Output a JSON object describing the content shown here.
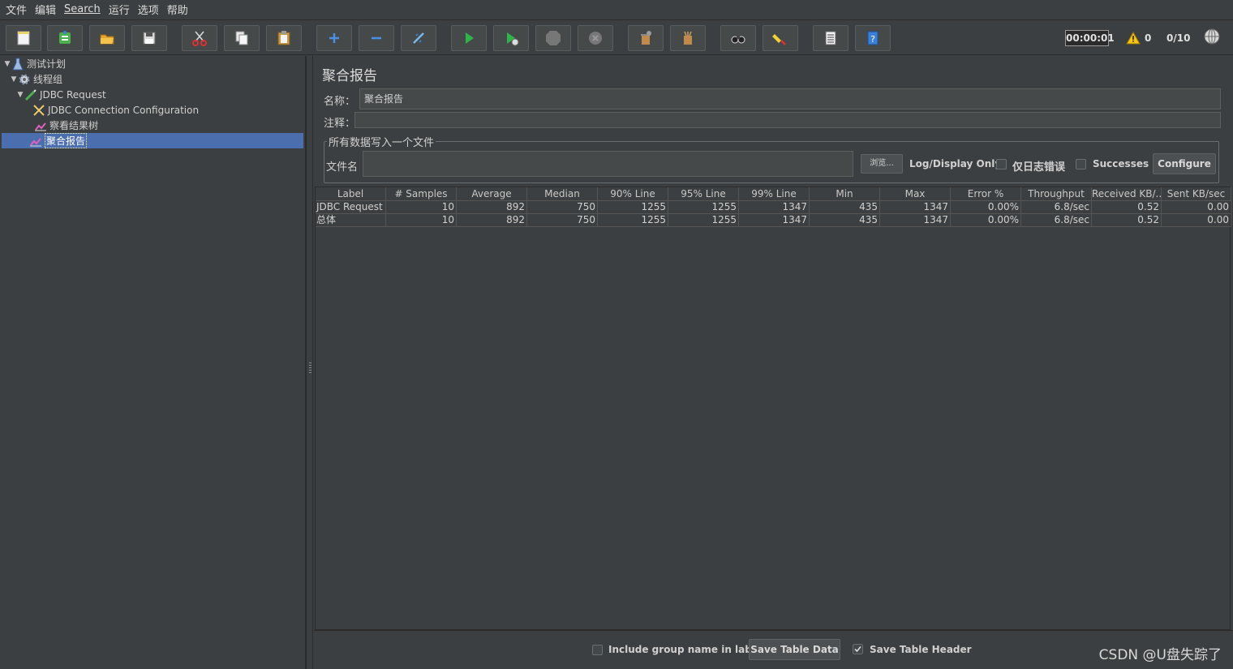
{
  "menu": [
    "文件",
    "编辑",
    "Search",
    "运行",
    "选项",
    "帮助"
  ],
  "toolbar": {
    "icons": [
      "new-icon",
      "templates-icon",
      "open-icon",
      "save-icon",
      "cut-icon",
      "copy-icon",
      "paste-icon",
      "expand-icon",
      "collapse-icon",
      "toggle-icon",
      "start-icon",
      "start-no-pause-icon",
      "stop-icon",
      "shutdown-icon",
      "clear-icon",
      "clear-all-icon",
      "search-icon",
      "reset-search-icon",
      "function-helper-icon",
      "help-icon"
    ],
    "timer": "00:00:01",
    "warnings": "0",
    "threads": "0/10"
  },
  "tree": [
    {
      "label": "测试计划",
      "icon": "test-plan-icon",
      "expanded": true
    },
    {
      "label": "线程组",
      "icon": "thread-group-icon",
      "expanded": true
    },
    {
      "label": "JDBC Request",
      "icon": "jdbc-request-icon",
      "expanded": true
    },
    {
      "label": "JDBC Connection Configuration",
      "icon": "config-icon"
    },
    {
      "label": "察看结果树",
      "icon": "listener-icon"
    },
    {
      "label": "聚合报告",
      "icon": "listener-icon",
      "selected": true
    }
  ],
  "panel": {
    "title": "聚合报告",
    "name_label": "名称：",
    "name_value": "聚合报告",
    "comment_label": "注释：",
    "comment_value": "",
    "file_group_title": "所有数据写入一个文件",
    "filename_label": "文件名",
    "filename_value": "",
    "browse_label": "浏览...",
    "log_display_label": "Log/Display Only:",
    "errors_only_label": "仅日志错误",
    "successes_label": "Successes",
    "configure_label": "Configure"
  },
  "table": {
    "headers": [
      "Label",
      "# Samples",
      "Average",
      "Median",
      "90% Line",
      "95% Line",
      "99% Line",
      "Min",
      "Max",
      "Error %",
      "Throughput",
      "Received KB/...",
      "Sent KB/sec"
    ],
    "rows": [
      [
        "JDBC Request",
        "10",
        "892",
        "750",
        "1255",
        "1255",
        "1347",
        "435",
        "1347",
        "0.00%",
        "6.8/sec",
        "0.52",
        "0.00"
      ],
      [
        "总体",
        "10",
        "892",
        "750",
        "1255",
        "1255",
        "1347",
        "435",
        "1347",
        "0.00%",
        "6.8/sec",
        "0.52",
        "0.00"
      ]
    ]
  },
  "footer": {
    "include_group_label": "Include group name in label?",
    "include_group_checked": false,
    "save_table_data_label": "Save Table Data",
    "save_table_header_label": "Save Table Header",
    "save_table_header_checked": true
  },
  "watermark": "CSDN @U盘失踪了"
}
